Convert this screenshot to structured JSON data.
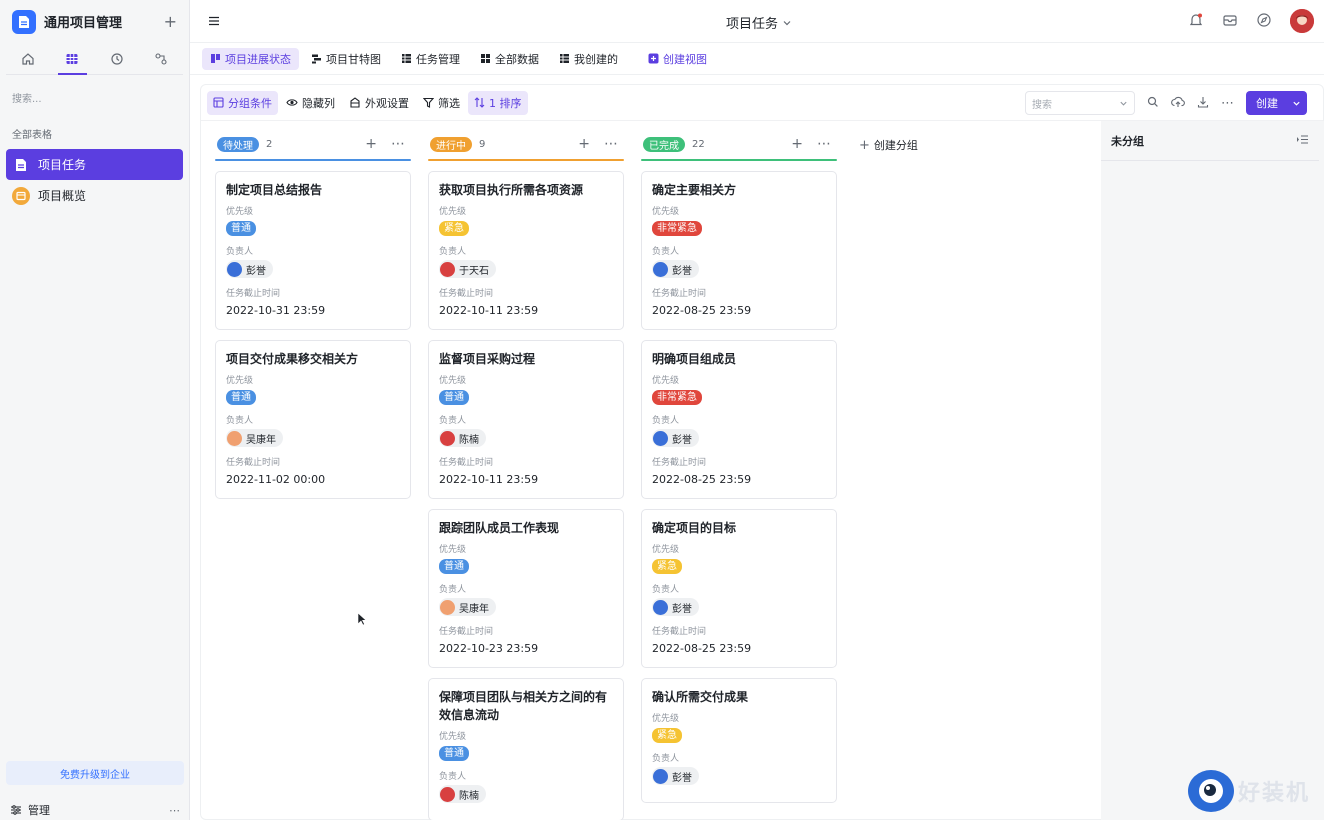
{
  "app": {
    "title": "通用项目管理",
    "add_label": "+"
  },
  "sidebar": {
    "search_placeholder": "搜索...",
    "section_label": "全部表格",
    "items": [
      {
        "label": "项目任务",
        "icon": "document-icon",
        "active": true
      },
      {
        "label": "项目概览",
        "icon": "dashboard-icon",
        "active": false
      }
    ],
    "upgrade_label": "免费升级到企业",
    "manage_label": "管理",
    "manage_more": "⋯"
  },
  "topbar": {
    "title": "项目任务"
  },
  "view_tabs": [
    {
      "label": "项目进展状态",
      "icon": "kanban-icon",
      "active": true
    },
    {
      "label": "项目甘特图",
      "icon": "gantt-icon",
      "active": false
    },
    {
      "label": "任务管理",
      "icon": "table-icon",
      "active": false
    },
    {
      "label": "全部数据",
      "icon": "grid-icon",
      "active": false
    },
    {
      "label": "我创建的",
      "icon": "table-icon",
      "active": false
    }
  ],
  "create_view_label": "创建视图",
  "toolbar": {
    "group_label": "分组条件",
    "hide_label": "隐藏列",
    "appearance_label": "外观设置",
    "filter_label": "筛选",
    "sort_label": "1 排序",
    "search_placeholder": "搜索",
    "more": "⋯",
    "create_label": "创建"
  },
  "fields": {
    "priority": "优先级",
    "owner": "负责人",
    "deadline": "任务截止时间"
  },
  "columns": [
    {
      "status": "待处理",
      "count": "2",
      "color": "#4a90e2",
      "cards": [
        {
          "title": "制定项目总结报告",
          "priority": "普通",
          "owner": "彭誉",
          "deadline": "2022-10-31 23:59"
        },
        {
          "title": "项目交付成果移交相关方",
          "priority": "普通",
          "owner": "吴康年",
          "deadline": "2022-11-02 00:00"
        }
      ]
    },
    {
      "status": "进行中",
      "count": "9",
      "color": "#f0a030",
      "cards": [
        {
          "title": "获取项目执行所需各项资源",
          "priority": "紧急",
          "owner": "于天石",
          "deadline": "2022-10-11 23:59"
        },
        {
          "title": "监督项目采购过程",
          "priority": "普通",
          "owner": "陈楠",
          "deadline": "2022-10-11 23:59"
        },
        {
          "title": "跟踪团队成员工作表现",
          "priority": "普通",
          "owner": "吴康年",
          "deadline": "2022-10-23 23:59"
        },
        {
          "title": "保障项目团队与相关方之间的有效信息流动",
          "priority": "普通",
          "owner": "陈楠",
          "deadline": ""
        }
      ]
    },
    {
      "status": "已完成",
      "count": "22",
      "color": "#3ec07a",
      "cards": [
        {
          "title": "确定主要相关方",
          "priority": "非常紧急",
          "owner": "彭誉",
          "deadline": "2022-08-25 23:59"
        },
        {
          "title": "明确项目组成员",
          "priority": "非常紧急",
          "owner": "彭誉",
          "deadline": "2022-08-25 23:59"
        },
        {
          "title": "确定项目的目标",
          "priority": "紧急",
          "owner": "彭誉",
          "deadline": "2022-08-25 23:59"
        },
        {
          "title": "确认所需交付成果",
          "priority": "紧急",
          "owner": "彭誉",
          "deadline": ""
        }
      ]
    }
  ],
  "priority_colors": {
    "普通": "#4a90e2",
    "紧急": "#f5c332",
    "非常紧急": "#e0463c"
  },
  "create_group_label": "创建分组",
  "ungrouped_label": "未分组",
  "watermark": "好装机"
}
